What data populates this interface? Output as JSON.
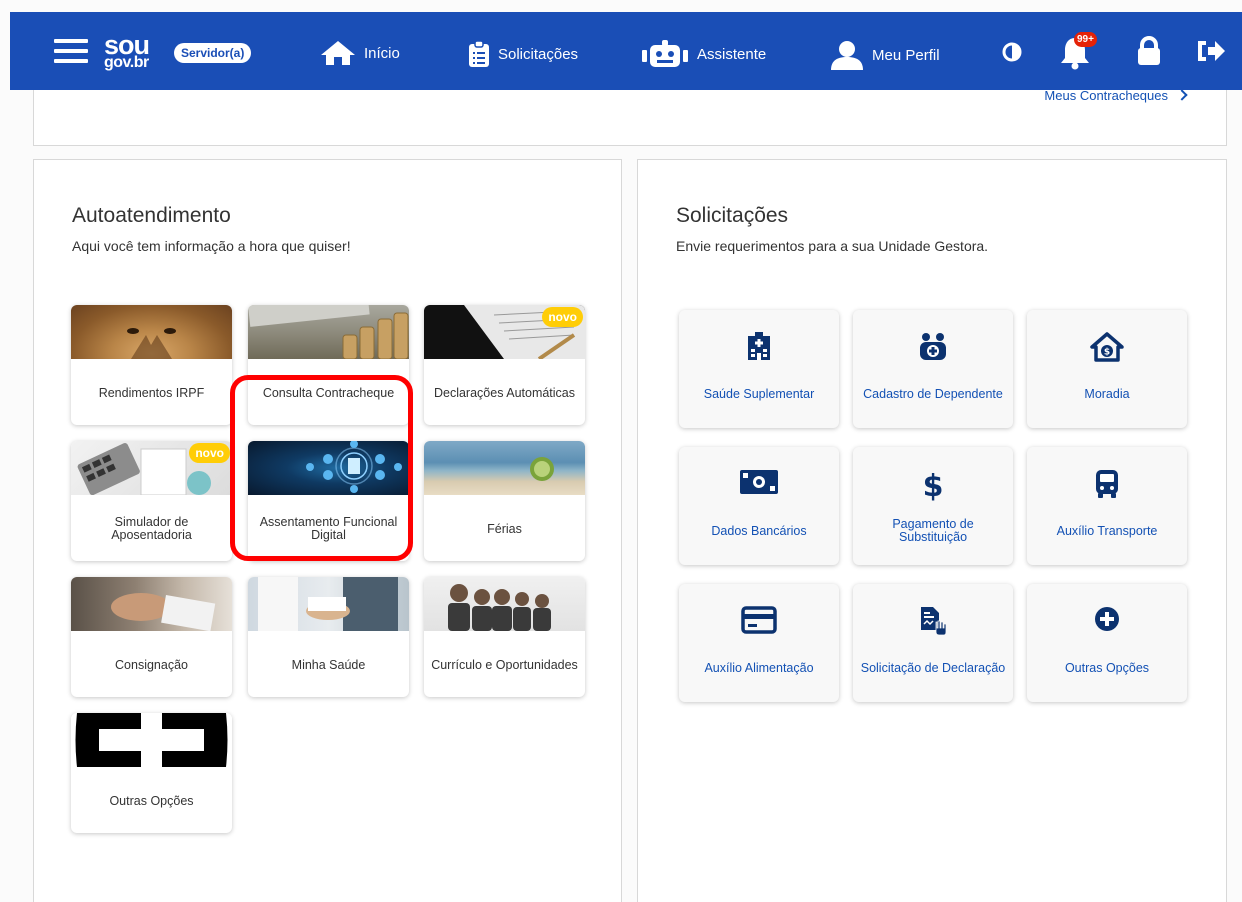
{
  "header": {
    "logo_line1": "sou",
    "logo_line2": "gov.br",
    "role_badge": "Servidor(a)",
    "nav": {
      "inicio": "Início",
      "solicitacoes": "Solicitações",
      "assistente": "Assistente",
      "perfil": "Meu Perfil"
    },
    "notification_count": "99+"
  },
  "top_card": {
    "link": "Meus Contracheques"
  },
  "autoatendimento": {
    "title": "Autoatendimento",
    "subtitle": "Aqui você tem informação a hora que quiser!",
    "tiles": [
      {
        "label": "Rendimentos  IRPF"
      },
      {
        "label": "Consulta Contracheque"
      },
      {
        "label": "Declarações Automáticas",
        "badge": "novo"
      },
      {
        "label": "Simulador de Aposentadoria",
        "badge": "novo"
      },
      {
        "label": "Assentamento Funcional Digital"
      },
      {
        "label": "Férias"
      },
      {
        "label": "Consignação"
      },
      {
        "label": "Minha Saúde"
      },
      {
        "label": "Currículo e Oportunidades"
      },
      {
        "label": "Outras Opções"
      }
    ]
  },
  "solicitacoes": {
    "title": "Solicitações",
    "subtitle": "Envie requerimentos para a sua Unidade Gestora.",
    "tiles": [
      {
        "label": "Saúde Suplementar"
      },
      {
        "label": "Cadastro de Dependente"
      },
      {
        "label": "Moradia"
      },
      {
        "label": "Dados Bancários"
      },
      {
        "label": "Pagamento de Substituição"
      },
      {
        "label": "Auxílio Transporte"
      },
      {
        "label": "Auxílio Alimentação"
      },
      {
        "label": "Solicitação de Declaração"
      },
      {
        "label": "Outras Opções"
      }
    ]
  },
  "colors": {
    "primary": "#1a4eb6",
    "link": "#1351b4",
    "badge": "#ffcd07",
    "highlight": "#ff0000"
  }
}
